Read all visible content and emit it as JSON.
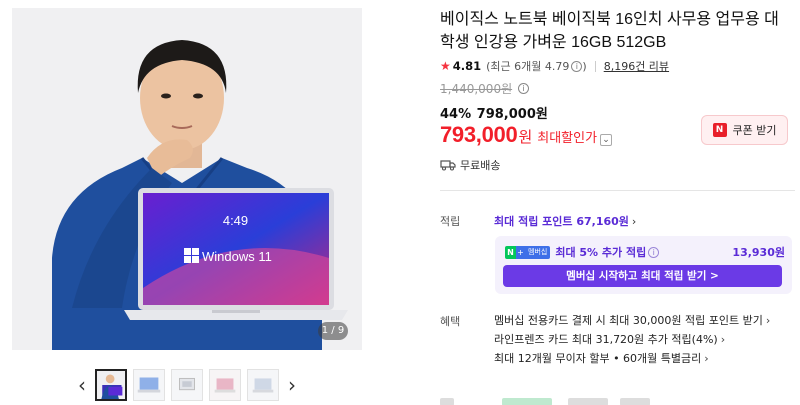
{
  "gallery": {
    "counter": "1 / 9",
    "laptop_time": "4:49",
    "laptop_brand": "Windows 11",
    "prev_icon": "chevron-left-icon",
    "next_icon": "chevron-right-icon",
    "thumbnails": [
      "thumb-1",
      "thumb-2",
      "thumb-3",
      "thumb-4",
      "thumb-5"
    ]
  },
  "product": {
    "title": "베이직스 노트북 베이직북 16인치 사무용 업무용 대학생 인강용 가벼운 16GB 512GB",
    "rating": "4.81",
    "recent_rating": "(최근 6개월 4.79",
    "recent_close": ")",
    "info_glyph": "i",
    "review_count": "8,196건 리뷰"
  },
  "price": {
    "original": "1,440,000원",
    "discount_rate": "44%",
    "sale_price": "798,000원",
    "final_price": "793,000",
    "final_unit": "원",
    "final_label": "최대할인가",
    "coupon_badge": "N",
    "coupon_label": "쿠폰 받기",
    "shipping": "무료배송"
  },
  "points": {
    "label": "적립",
    "max_points": "최대 적립 포인트 67,160원",
    "membership_badge_n": "N",
    "membership_badge_plus": "+",
    "membership_badge_text": "멤버십",
    "membership_text": "최대 5% 추가 적립",
    "membership_amount": "13,930원",
    "membership_cta": "멤버십 시작하고 최대 적립 받기 >"
  },
  "benefits": {
    "label": "혜택",
    "items": [
      "멤버십 전용카드 결제 시 최대 30,000원 적립 포인트 받기",
      "라인프렌즈 카드 최대 31,720원 추가 적립(4%)",
      "최대 12개월 무이자 할부 • 60개월 특별금리"
    ]
  },
  "colors": {
    "accent_red": "#f21f2a",
    "accent_purple": "#5a2bd6",
    "cta_purple": "#6b3ae6",
    "naver_green": "#03c75a"
  }
}
